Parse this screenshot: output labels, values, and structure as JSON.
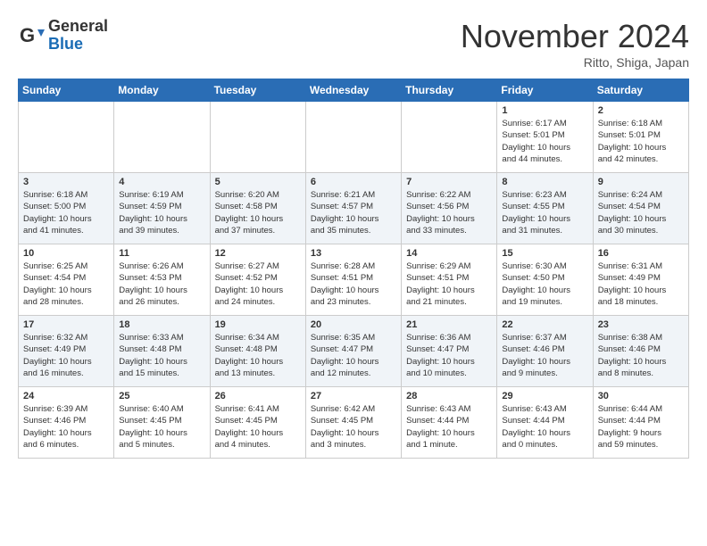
{
  "header": {
    "logo_general": "General",
    "logo_blue": "Blue",
    "month_title": "November 2024",
    "location": "Ritto, Shiga, Japan"
  },
  "weekdays": [
    "Sunday",
    "Monday",
    "Tuesday",
    "Wednesday",
    "Thursday",
    "Friday",
    "Saturday"
  ],
  "weeks": [
    [
      {
        "num": "",
        "info": ""
      },
      {
        "num": "",
        "info": ""
      },
      {
        "num": "",
        "info": ""
      },
      {
        "num": "",
        "info": ""
      },
      {
        "num": "",
        "info": ""
      },
      {
        "num": "1",
        "info": "Sunrise: 6:17 AM\nSunset: 5:01 PM\nDaylight: 10 hours\nand 44 minutes."
      },
      {
        "num": "2",
        "info": "Sunrise: 6:18 AM\nSunset: 5:01 PM\nDaylight: 10 hours\nand 42 minutes."
      }
    ],
    [
      {
        "num": "3",
        "info": "Sunrise: 6:18 AM\nSunset: 5:00 PM\nDaylight: 10 hours\nand 41 minutes."
      },
      {
        "num": "4",
        "info": "Sunrise: 6:19 AM\nSunset: 4:59 PM\nDaylight: 10 hours\nand 39 minutes."
      },
      {
        "num": "5",
        "info": "Sunrise: 6:20 AM\nSunset: 4:58 PM\nDaylight: 10 hours\nand 37 minutes."
      },
      {
        "num": "6",
        "info": "Sunrise: 6:21 AM\nSunset: 4:57 PM\nDaylight: 10 hours\nand 35 minutes."
      },
      {
        "num": "7",
        "info": "Sunrise: 6:22 AM\nSunset: 4:56 PM\nDaylight: 10 hours\nand 33 minutes."
      },
      {
        "num": "8",
        "info": "Sunrise: 6:23 AM\nSunset: 4:55 PM\nDaylight: 10 hours\nand 31 minutes."
      },
      {
        "num": "9",
        "info": "Sunrise: 6:24 AM\nSunset: 4:54 PM\nDaylight: 10 hours\nand 30 minutes."
      }
    ],
    [
      {
        "num": "10",
        "info": "Sunrise: 6:25 AM\nSunset: 4:54 PM\nDaylight: 10 hours\nand 28 minutes."
      },
      {
        "num": "11",
        "info": "Sunrise: 6:26 AM\nSunset: 4:53 PM\nDaylight: 10 hours\nand 26 minutes."
      },
      {
        "num": "12",
        "info": "Sunrise: 6:27 AM\nSunset: 4:52 PM\nDaylight: 10 hours\nand 24 minutes."
      },
      {
        "num": "13",
        "info": "Sunrise: 6:28 AM\nSunset: 4:51 PM\nDaylight: 10 hours\nand 23 minutes."
      },
      {
        "num": "14",
        "info": "Sunrise: 6:29 AM\nSunset: 4:51 PM\nDaylight: 10 hours\nand 21 minutes."
      },
      {
        "num": "15",
        "info": "Sunrise: 6:30 AM\nSunset: 4:50 PM\nDaylight: 10 hours\nand 19 minutes."
      },
      {
        "num": "16",
        "info": "Sunrise: 6:31 AM\nSunset: 4:49 PM\nDaylight: 10 hours\nand 18 minutes."
      }
    ],
    [
      {
        "num": "17",
        "info": "Sunrise: 6:32 AM\nSunset: 4:49 PM\nDaylight: 10 hours\nand 16 minutes."
      },
      {
        "num": "18",
        "info": "Sunrise: 6:33 AM\nSunset: 4:48 PM\nDaylight: 10 hours\nand 15 minutes."
      },
      {
        "num": "19",
        "info": "Sunrise: 6:34 AM\nSunset: 4:48 PM\nDaylight: 10 hours\nand 13 minutes."
      },
      {
        "num": "20",
        "info": "Sunrise: 6:35 AM\nSunset: 4:47 PM\nDaylight: 10 hours\nand 12 minutes."
      },
      {
        "num": "21",
        "info": "Sunrise: 6:36 AM\nSunset: 4:47 PM\nDaylight: 10 hours\nand 10 minutes."
      },
      {
        "num": "22",
        "info": "Sunrise: 6:37 AM\nSunset: 4:46 PM\nDaylight: 10 hours\nand 9 minutes."
      },
      {
        "num": "23",
        "info": "Sunrise: 6:38 AM\nSunset: 4:46 PM\nDaylight: 10 hours\nand 8 minutes."
      }
    ],
    [
      {
        "num": "24",
        "info": "Sunrise: 6:39 AM\nSunset: 4:46 PM\nDaylight: 10 hours\nand 6 minutes."
      },
      {
        "num": "25",
        "info": "Sunrise: 6:40 AM\nSunset: 4:45 PM\nDaylight: 10 hours\nand 5 minutes."
      },
      {
        "num": "26",
        "info": "Sunrise: 6:41 AM\nSunset: 4:45 PM\nDaylight: 10 hours\nand 4 minutes."
      },
      {
        "num": "27",
        "info": "Sunrise: 6:42 AM\nSunset: 4:45 PM\nDaylight: 10 hours\nand 3 minutes."
      },
      {
        "num": "28",
        "info": "Sunrise: 6:43 AM\nSunset: 4:44 PM\nDaylight: 10 hours\nand 1 minute."
      },
      {
        "num": "29",
        "info": "Sunrise: 6:43 AM\nSunset: 4:44 PM\nDaylight: 10 hours\nand 0 minutes."
      },
      {
        "num": "30",
        "info": "Sunrise: 6:44 AM\nSunset: 4:44 PM\nDaylight: 9 hours\nand 59 minutes."
      }
    ]
  ]
}
